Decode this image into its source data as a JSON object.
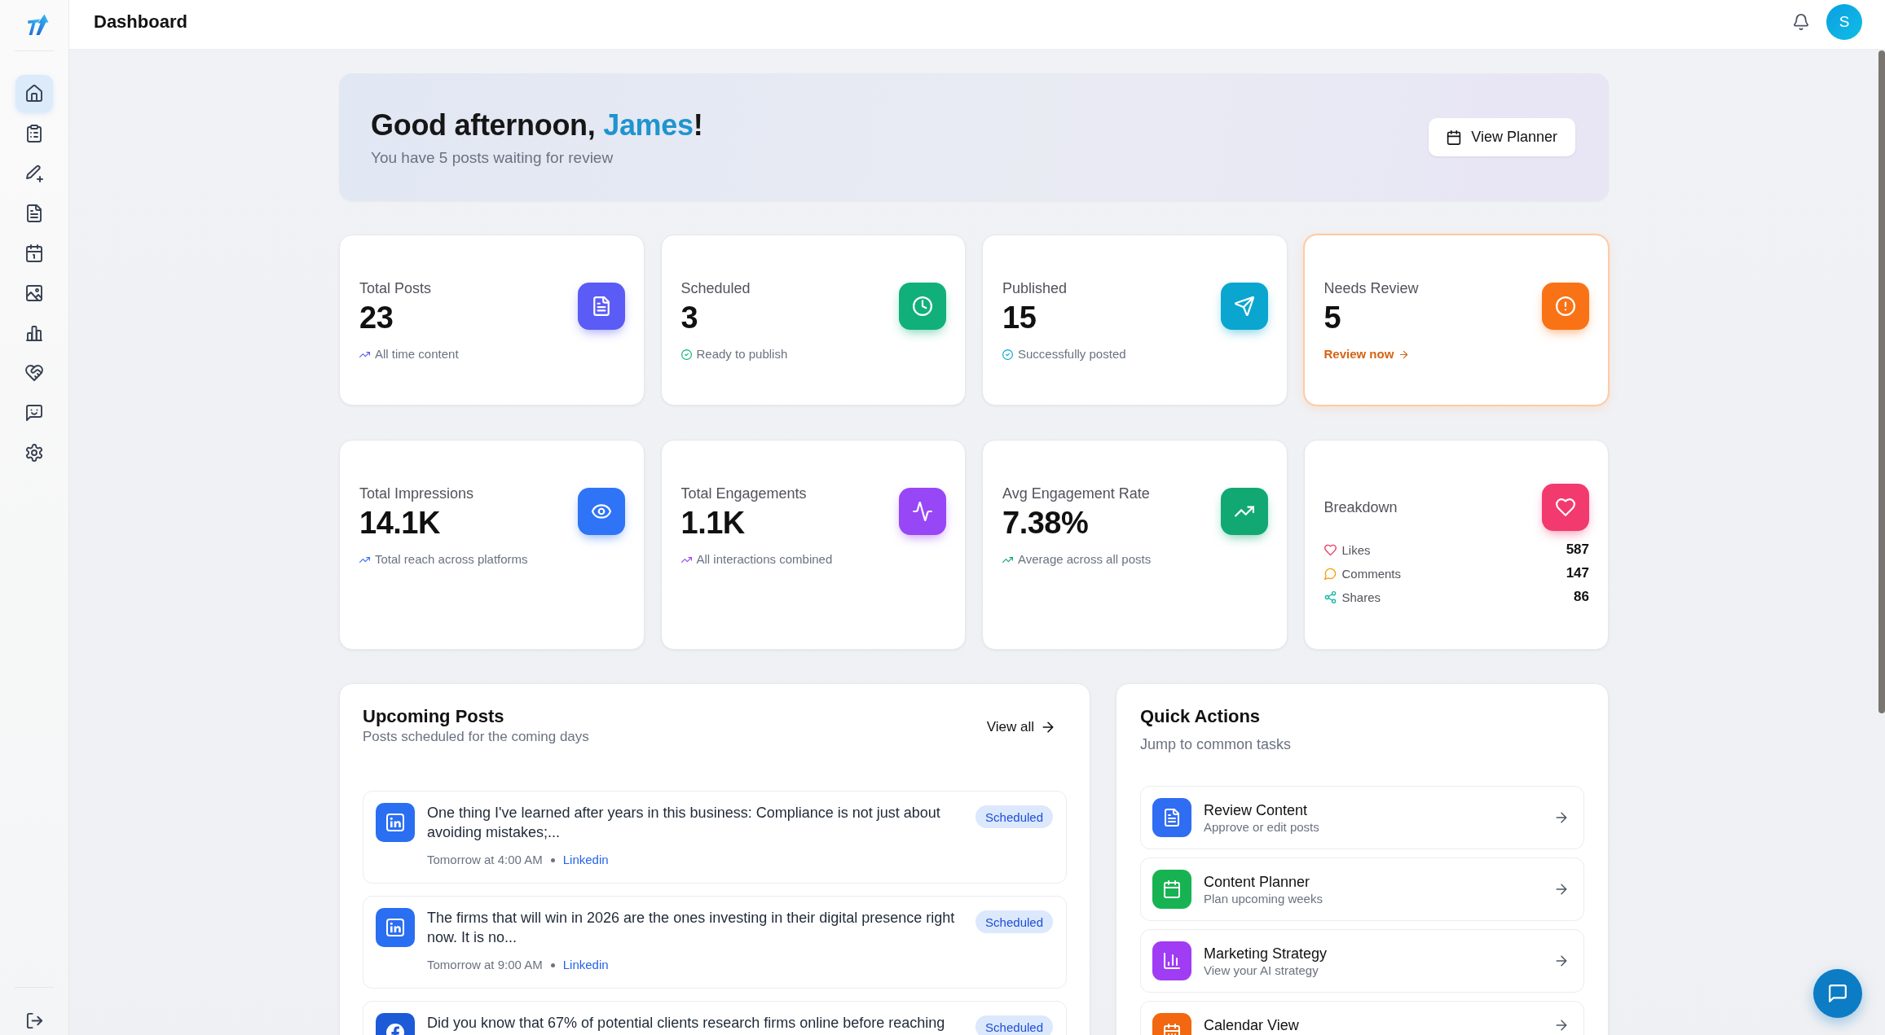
{
  "sidebar": {
    "items": [
      {
        "selected": true
      },
      {
        "selected": false
      },
      {
        "selected": false
      },
      {
        "selected": false
      },
      {
        "selected": false
      },
      {
        "selected": false
      },
      {
        "selected": false
      },
      {
        "selected": false
      },
      {
        "selected": false
      },
      {
        "selected": false
      }
    ]
  },
  "header": {
    "title": "Dashboard",
    "avatar_initial": "S"
  },
  "welcome": {
    "greeting": "Good afternoon,",
    "name": "James",
    "greeting_end": "!",
    "subtitle": "You have 5 posts waiting for review",
    "button": "View Planner"
  },
  "stats": [
    {
      "kind": "metric",
      "label": "Total Posts",
      "value": "23",
      "note": {
        "kind": "trend",
        "text": "All time content"
      },
      "color": "#5b5bf6",
      "highlighted": false
    },
    {
      "kind": "metric",
      "label": "Scheduled",
      "value": "3",
      "note": {
        "kind": "check",
        "text": "Ready to publish"
      },
      "color": "#11b07a",
      "highlighted": false
    },
    {
      "kind": "metric",
      "label": "Published",
      "value": "15",
      "note": {
        "kind": "check",
        "text": "Successfully posted"
      },
      "color": "#0aa6cf",
      "highlighted": false
    },
    {
      "kind": "metric",
      "label": "Needs Review",
      "value": "5",
      "note": {
        "kind": "link",
        "text": "Review now"
      },
      "color": "#f97316",
      "highlighted": true
    },
    {
      "kind": "metric",
      "label": "Total Impressions",
      "value": "14.1K",
      "note": {
        "kind": "trend",
        "text": "Total reach across platforms"
      },
      "color": "#2f74f6",
      "highlighted": false
    },
    {
      "kind": "metric",
      "label": "Total Engagements",
      "value": "1.1K",
      "note": {
        "kind": "trend",
        "text": "All interactions combined"
      },
      "color": "#9747f5",
      "highlighted": false
    },
    {
      "kind": "metric",
      "label": "Avg Engagement Rate",
      "value": "7.38%",
      "note": {
        "kind": "trend",
        "text": "Average across all posts"
      },
      "color": "#11a874",
      "highlighted": false
    },
    {
      "kind": "breakdown",
      "label": "Breakdown",
      "color": "#f23a6e",
      "highlighted": false,
      "rows": [
        {
          "label": "Likes",
          "value": "587",
          "color": "#e8365d"
        },
        {
          "label": "Comments",
          "value": "147",
          "color": "#f59e0b"
        },
        {
          "label": "Shares",
          "value": "86",
          "color": "#14b8a6"
        }
      ]
    }
  ],
  "upcoming_posts": {
    "title": "Upcoming Posts",
    "subtitle": "Posts scheduled for the coming days",
    "link": "View all",
    "posts": [
      {
        "kind": "linkedin",
        "text": "One thing I've learned after years in this business: Compliance is not just about avoiding mistakes;...",
        "time": "Tomorrow at 4:00 AM",
        "platform": "Linkedin",
        "status": "Scheduled"
      },
      {
        "kind": "linkedin",
        "text": "The firms that will win in 2026 are the ones investing in their digital presence right now. It is no...",
        "time": "Tomorrow at 9:00 AM",
        "platform": "Linkedin",
        "status": "Scheduled"
      },
      {
        "kind": "facebook",
        "text": "Did you know that 67% of potential clients research firms online before reaching",
        "status": "Scheduled"
      }
    ]
  },
  "quick_actions": {
    "title": "Quick Actions",
    "subtitle": "Jump to common tasks",
    "items": [
      {
        "title": "Review Content",
        "subtitle": "Approve or edit posts",
        "color": "#2f6df3"
      },
      {
        "title": "Content Planner",
        "subtitle": "Plan upcoming weeks",
        "color": "#17b352"
      },
      {
        "title": "Marketing Strategy",
        "subtitle": "View your AI strategy",
        "color": "#a03cf3"
      },
      {
        "title": "Calendar View",
        "color": "#f2670f"
      }
    ]
  }
}
